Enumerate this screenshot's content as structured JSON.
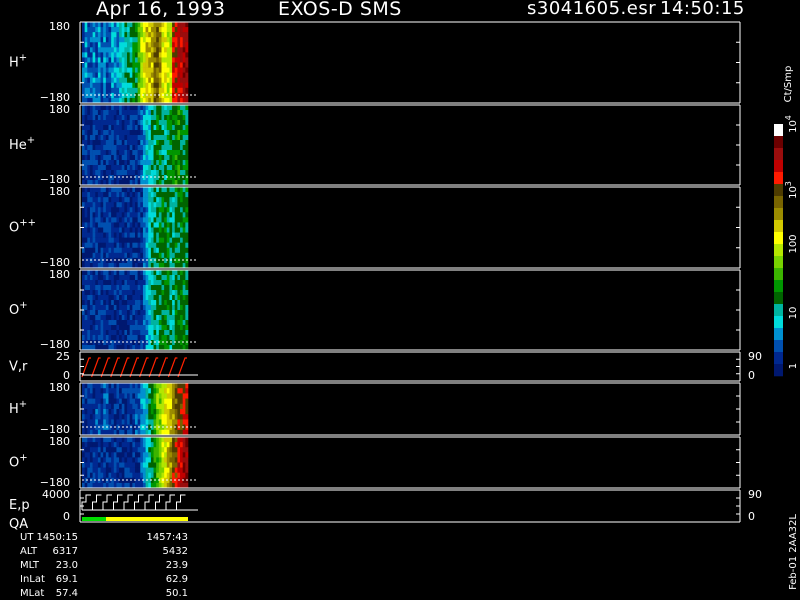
{
  "header": {
    "date": "Apr 16, 1993",
    "instrument": "EXOS-D SMS",
    "file": "s3041605.esr",
    "time": "14:50:15"
  },
  "panels": [
    {
      "label": "H",
      "sup": "+",
      "ytop": "180",
      "ybot": "−180",
      "right_top": "",
      "right_bot": ""
    },
    {
      "label": "He",
      "sup": "+",
      "ytop": "180",
      "ybot": "−180",
      "right_top": "",
      "right_bot": ""
    },
    {
      "label": "O",
      "sup": "++",
      "ytop": "180",
      "ybot": "−180",
      "right_top": "",
      "right_bot": ""
    },
    {
      "label": "O",
      "sup": "+",
      "ytop": "180",
      "ybot": "−180",
      "right_top": "",
      "right_bot": ""
    },
    {
      "label": "V,r",
      "sup": "",
      "ytop": "25",
      "ybot": "0",
      "right_top": "90",
      "right_bot": "0"
    },
    {
      "label": "H",
      "sup": "+",
      "ytop": "180",
      "ybot": "−180",
      "right_top": "",
      "right_bot": ""
    },
    {
      "label": "O",
      "sup": "+",
      "ytop": "180",
      "ybot": "−180",
      "right_top": "",
      "right_bot": ""
    },
    {
      "label": "E,p",
      "label2": "QA",
      "sup": "",
      "ytop": "4000",
      "ybot": "0",
      "right_top": "90",
      "right_bot": "0"
    }
  ],
  "colorbar": {
    "unit": "Ct/Smp",
    "ticks": [
      {
        "base": "10",
        "exp": "4"
      },
      {
        "base": "10",
        "exp": "3"
      },
      {
        "base": "100",
        "exp": ""
      },
      {
        "base": "10",
        "exp": ""
      },
      {
        "base": "1",
        "exp": ""
      }
    ],
    "colors": [
      "#ffffff",
      "#6b0000",
      "#9a0d0d",
      "#c00000",
      "#ff1a00",
      "#4e3c00",
      "#786400",
      "#9b8c00",
      "#d2c800",
      "#ffff00",
      "#b4e600",
      "#78d200",
      "#3cb400",
      "#009600",
      "#006400",
      "#00b4a0",
      "#00dcdc",
      "#0090d0",
      "#0050b0",
      "#002890",
      "#001870"
    ],
    "color_stops_note": ""
  },
  "footer": {
    "rows": [
      {
        "name": "UT",
        "v1": "1450:15",
        "v2": "1457:43"
      },
      {
        "name": "ALT",
        "v1": "6317",
        "v2": "5432"
      },
      {
        "name": "MLT",
        "v1": "23.0",
        "v2": "23.9"
      },
      {
        "name": "InLat",
        "v1": "69.1",
        "v2": "62.9"
      },
      {
        "name": "MLat",
        "v1": "57.4",
        "v2": "50.1"
      }
    ],
    "stamp": "Feb-01  2AA32L"
  },
  "chart_data": {
    "type": "heatmap",
    "title": "Apr 16, 1993   EXOS-D SMS",
    "xlabel": "UT",
    "x_range": [
      "1450:15",
      "1457:43"
    ],
    "panels": [
      {
        "name": "H+",
        "ylim": [
          -180,
          180
        ]
      },
      {
        "name": "He+",
        "ylim": [
          -180,
          180
        ]
      },
      {
        "name": "O++",
        "ylim": [
          -180,
          180
        ]
      },
      {
        "name": "O+",
        "ylim": [
          -180,
          180
        ]
      },
      {
        "name": "V,r",
        "ylim": [
          0,
          25
        ],
        "right_ylim": [
          0,
          90
        ]
      },
      {
        "name": "H+",
        "ylim": [
          -180,
          180
        ]
      },
      {
        "name": "O+",
        "ylim": [
          -180,
          180
        ]
      },
      {
        "name": "E,p / QA",
        "ylim": [
          0,
          4000
        ],
        "right_ylim": [
          0,
          90
        ]
      }
    ],
    "colorbar": {
      "label": "Ct/Smp",
      "scale": "log",
      "range": [
        1,
        10000
      ]
    }
  }
}
